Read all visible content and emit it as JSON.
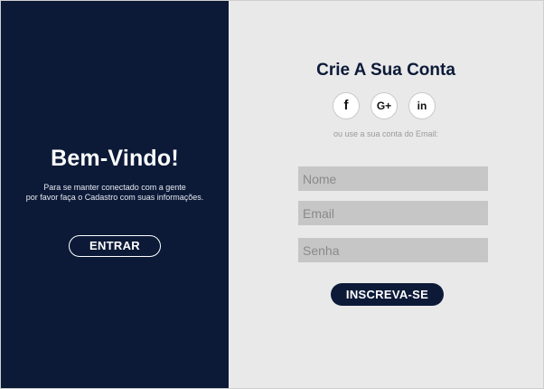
{
  "welcome_panel": {
    "title": "Bem-Vindo!",
    "subtitle_line1": "Para se manter conectado com a gente",
    "subtitle_line2": "por favor faça o Cadastro com suas informações.",
    "login_button": "ENTRAR",
    "background_color": "#0c1a38"
  },
  "signup_panel": {
    "title": "Crie A Sua Conta",
    "social": [
      {
        "label": "f",
        "icon": "facebook-icon"
      },
      {
        "label": "G+",
        "icon": "google-plus-icon"
      },
      {
        "label": "in",
        "icon": "linkedin-icon"
      }
    ],
    "hint": "ou use a sua conta do Email:",
    "fields": {
      "name_placeholder": "Nome",
      "email_placeholder": "Email",
      "password_placeholder": "Senha"
    },
    "submit_button": "INSCREVA-SE",
    "accent_color": "#0c1a38"
  }
}
